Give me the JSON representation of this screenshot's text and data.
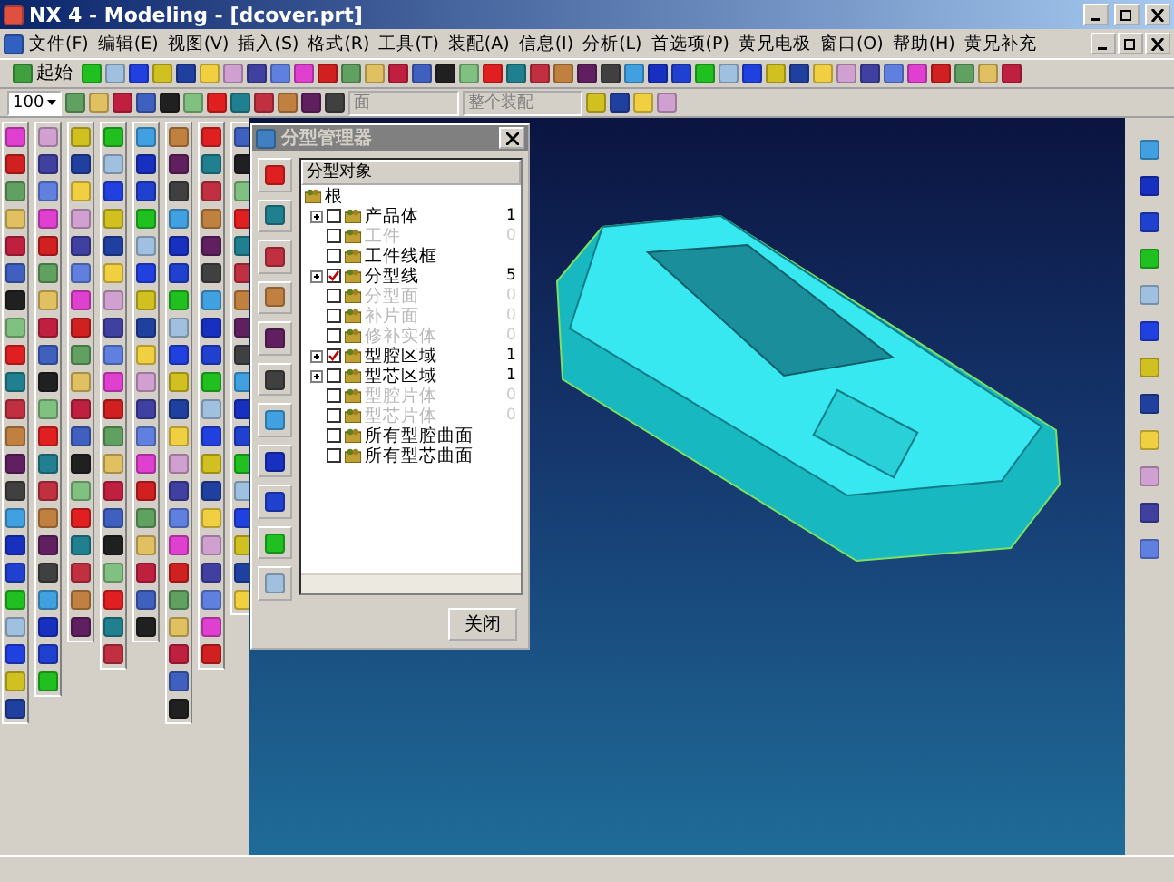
{
  "window": {
    "title": "NX 4 - Modeling - [dcover.prt]"
  },
  "menu": [
    "文件(F)",
    "编辑(E)",
    "视图(V)",
    "插入(S)",
    "格式(R)",
    "工具(T)",
    "装配(A)",
    "信息(I)",
    "分析(L)",
    "首选项(P)",
    "黄兄电极",
    "窗口(O)",
    "帮助(H)",
    "黄兄补充"
  ],
  "toolbar": {
    "start_label": "起始",
    "zoom_value": "100",
    "filter_value": "面",
    "scope_value": "整个装配"
  },
  "dialog": {
    "title": "分型管理器",
    "column_header": "分型对象",
    "root": "根",
    "items": [
      {
        "label": "产品体",
        "count": "1",
        "checked": false,
        "disabled": false,
        "expandable": true
      },
      {
        "label": "工件",
        "count": "0",
        "checked": false,
        "disabled": true,
        "expandable": false
      },
      {
        "label": "工件线框",
        "checked": false,
        "disabled": false,
        "expandable": false
      },
      {
        "label": "分型线",
        "count": "5",
        "checked": true,
        "disabled": false,
        "expandable": true
      },
      {
        "label": "分型面",
        "count": "0",
        "checked": false,
        "disabled": true,
        "expandable": false
      },
      {
        "label": "补片面",
        "count": "0",
        "checked": false,
        "disabled": true,
        "expandable": false
      },
      {
        "label": "修补实体",
        "count": "0",
        "checked": false,
        "disabled": true,
        "expandable": false
      },
      {
        "label": "型腔区域",
        "count": "1",
        "checked": true,
        "disabled": false,
        "expandable": true
      },
      {
        "label": "型芯区域",
        "count": "1",
        "checked": false,
        "disabled": false,
        "expandable": true
      },
      {
        "label": "型腔片体",
        "count": "0",
        "checked": false,
        "disabled": true,
        "expandable": false
      },
      {
        "label": "型芯片体",
        "count": "0",
        "checked": false,
        "disabled": true,
        "expandable": false
      },
      {
        "label": "所有型腔曲面",
        "checked": false,
        "disabled": false,
        "expandable": false
      },
      {
        "label": "所有型芯曲面",
        "checked": false,
        "disabled": false,
        "expandable": false
      }
    ],
    "close_button": "关闭"
  }
}
